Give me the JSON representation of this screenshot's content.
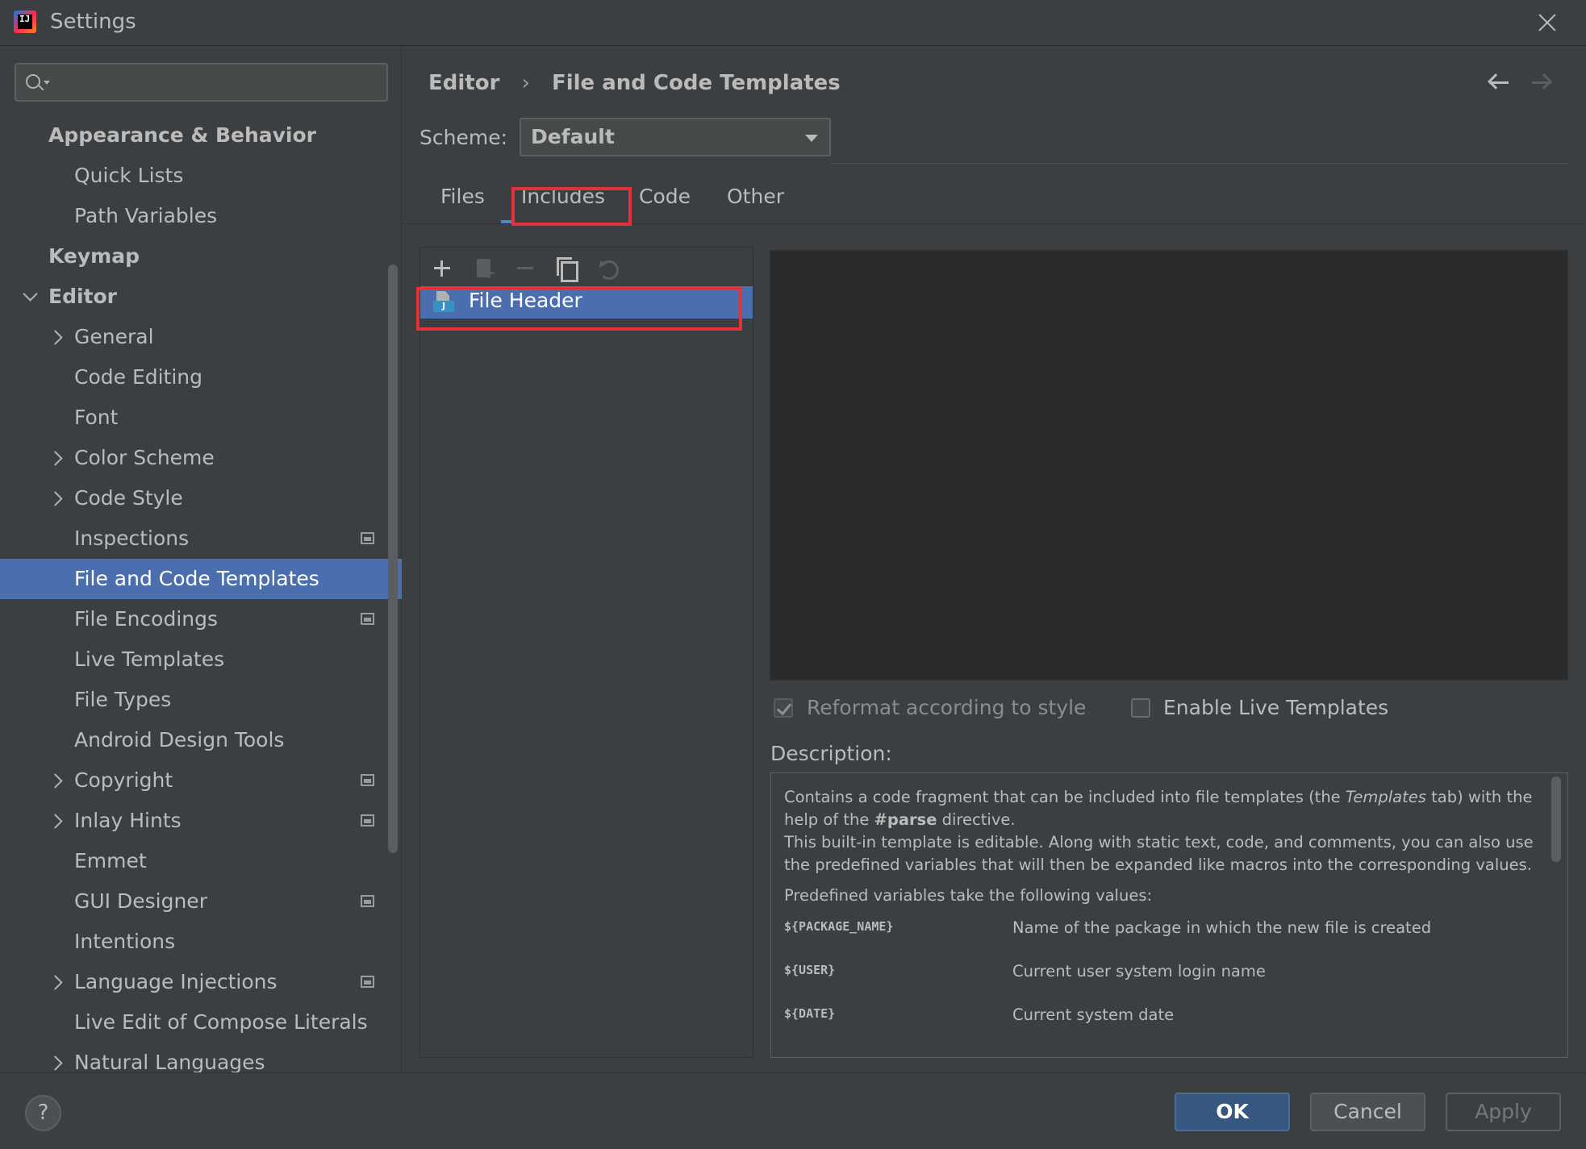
{
  "window": {
    "title": "Settings"
  },
  "search": {
    "placeholder": "",
    "value": ""
  },
  "sidebar": {
    "items": [
      {
        "label": "Appearance & Behavior",
        "level": 0,
        "group": true
      },
      {
        "label": "Quick Lists",
        "level": 1
      },
      {
        "label": "Path Variables",
        "level": 1
      },
      {
        "label": "Keymap",
        "level": 0,
        "group": true
      },
      {
        "label": "Editor",
        "level": 0,
        "group": true,
        "expanded": true
      },
      {
        "label": "General",
        "level": 1,
        "collapsed": true
      },
      {
        "label": "Code Editing",
        "level": 1
      },
      {
        "label": "Font",
        "level": 1
      },
      {
        "label": "Color Scheme",
        "level": 1,
        "collapsed": true
      },
      {
        "label": "Code Style",
        "level": 1,
        "collapsed": true
      },
      {
        "label": "Inspections",
        "level": 1,
        "project_icon": true
      },
      {
        "label": "File and Code Templates",
        "level": 1,
        "selected": true
      },
      {
        "label": "File Encodings",
        "level": 1,
        "project_icon": true
      },
      {
        "label": "Live Templates",
        "level": 1
      },
      {
        "label": "File Types",
        "level": 1
      },
      {
        "label": "Android Design Tools",
        "level": 1
      },
      {
        "label": "Copyright",
        "level": 1,
        "collapsed": true,
        "project_icon": true
      },
      {
        "label": "Inlay Hints",
        "level": 1,
        "collapsed": true,
        "project_icon": true
      },
      {
        "label": "Emmet",
        "level": 1
      },
      {
        "label": "GUI Designer",
        "level": 1,
        "project_icon": true
      },
      {
        "label": "Intentions",
        "level": 1
      },
      {
        "label": "Language Injections",
        "level": 1,
        "collapsed": true,
        "project_icon": true
      },
      {
        "label": "Live Edit of Compose Literals",
        "level": 1
      },
      {
        "label": "Natural Languages",
        "level": 1,
        "collapsed": true
      }
    ]
  },
  "breadcrumb": {
    "parent": "Editor",
    "separator": "›",
    "current": "File and Code Templates"
  },
  "scheme": {
    "label": "Scheme:",
    "value": "Default"
  },
  "tabs": [
    {
      "label": "Files"
    },
    {
      "label": "Includes",
      "active": true
    },
    {
      "label": "Code"
    },
    {
      "label": "Other"
    }
  ],
  "templates": {
    "toolbar": [
      "plus-icon",
      "add-child-icon",
      "minus-icon",
      "copy-icon",
      "undo-icon"
    ],
    "items": [
      {
        "label": "File Header",
        "selected": true
      }
    ]
  },
  "options": {
    "reformat": {
      "label": "Reformat according to style",
      "checked": true,
      "enabled": false
    },
    "live_templates": {
      "label": "Enable Live Templates",
      "checked": false
    }
  },
  "description": {
    "label": "Description:",
    "p1_before": "Contains a code fragment that can be included into file templates (the ",
    "p1_italic": "Templates",
    "p1_middle": " tab) with the help of the ",
    "p1_bold": "#parse",
    "p1_after": " directive.",
    "p2": "This built-in template is editable. Along with static text, code, and comments, you can also use the predefined variables that will then be expanded like macros into the corresponding values.",
    "p3": "Predefined variables take the following values:",
    "variables": [
      {
        "name": "${PACKAGE_NAME}",
        "desc": "Name of the package in which the new file is created"
      },
      {
        "name": "${USER}",
        "desc": "Current user system login name"
      },
      {
        "name": "${DATE}",
        "desc": "Current system date"
      }
    ]
  },
  "footer": {
    "help": "?",
    "ok": "OK",
    "cancel": "Cancel",
    "apply": "Apply"
  },
  "colors": {
    "selection": "#4b6eaf",
    "highlight_box": "#e53238",
    "background": "#3c3f41",
    "editor_bg": "#2b2b2b"
  }
}
